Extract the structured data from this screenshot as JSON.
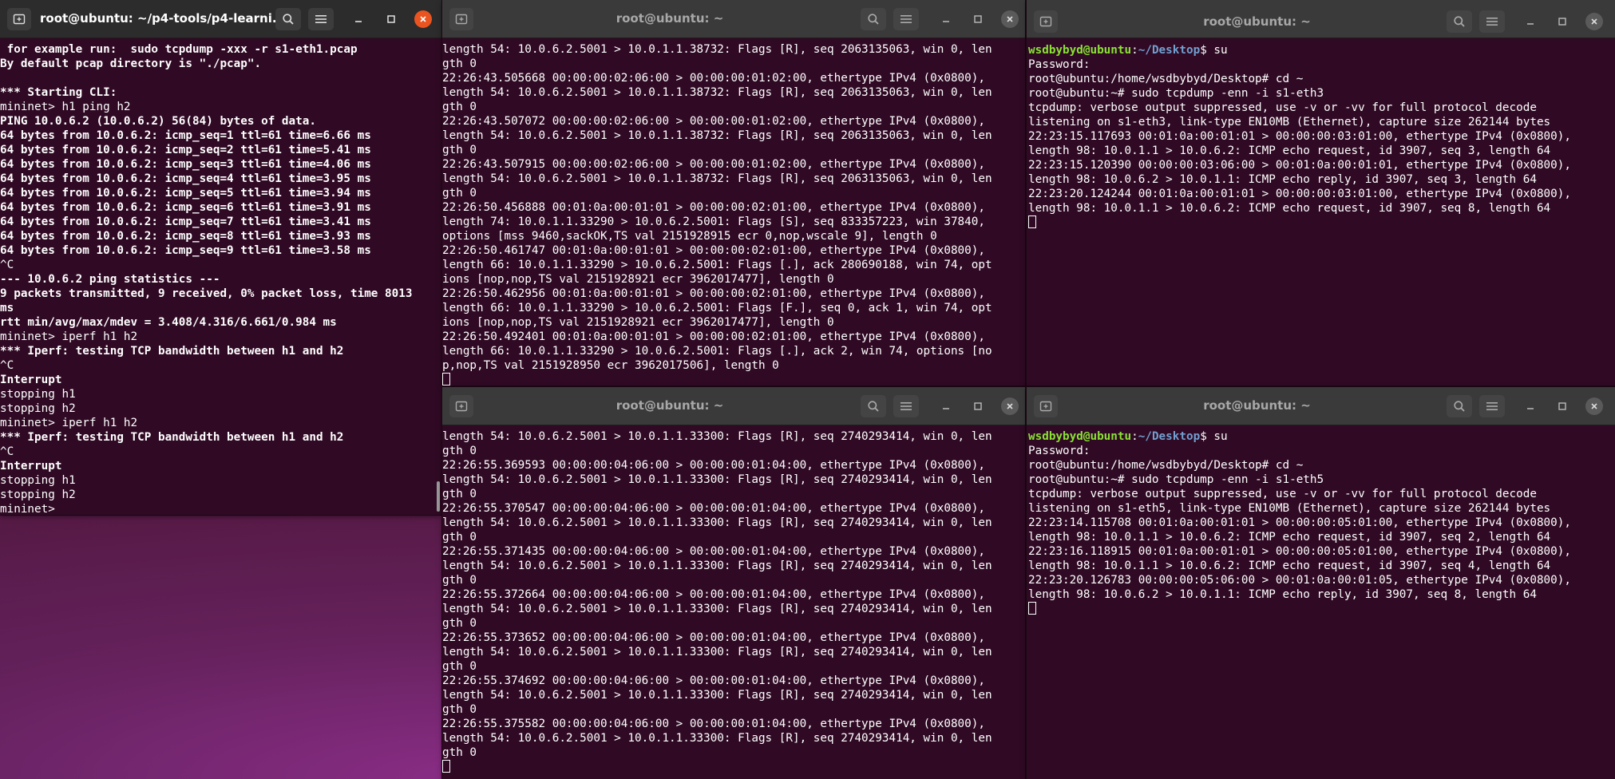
{
  "windows": [
    {
      "id": "terminal-mininet",
      "title": "root@ubuntu: ~/p4-tools/p4-learni...",
      "active": true,
      "lines": [
        [
          {
            "t": " for example run:  sudo tcpdump -xxx -r s1-eth1.pcap",
            "s": "b"
          }
        ],
        [
          {
            "t": "By default pcap directory is \"./pcap\".",
            "s": "b"
          }
        ],
        [
          {
            "t": ""
          }
        ],
        [
          {
            "t": "*** Starting CLI:",
            "s": "b"
          }
        ],
        [
          {
            "t": "mininet> h1 ping h2"
          }
        ],
        [
          {
            "t": "PING 10.0.6.2 (10.0.6.2) 56(84) bytes of data.",
            "s": "b"
          }
        ],
        [
          {
            "t": "64 bytes from 10.0.6.2: icmp_seq=1 ttl=61 time=6.66 ms",
            "s": "b"
          }
        ],
        [
          {
            "t": "64 bytes from 10.0.6.2: icmp_seq=2 ttl=61 time=5.41 ms",
            "s": "b"
          }
        ],
        [
          {
            "t": "64 bytes from 10.0.6.2: icmp_seq=3 ttl=61 time=4.06 ms",
            "s": "b"
          }
        ],
        [
          {
            "t": "64 bytes from 10.0.6.2: icmp_seq=4 ttl=61 time=3.95 ms",
            "s": "b"
          }
        ],
        [
          {
            "t": "64 bytes from 10.0.6.2: icmp_seq=5 ttl=61 time=3.94 ms",
            "s": "b"
          }
        ],
        [
          {
            "t": "64 bytes from 10.0.6.2: icmp_seq=6 ttl=61 time=3.91 ms",
            "s": "b"
          }
        ],
        [
          {
            "t": "64 bytes from 10.0.6.2: icmp_seq=7 ttl=61 time=3.41 ms",
            "s": "b"
          }
        ],
        [
          {
            "t": "64 bytes from 10.0.6.2: icmp_seq=8 ttl=61 time=3.93 ms",
            "s": "b"
          }
        ],
        [
          {
            "t": "64 bytes from 10.0.6.2: icmp_seq=9 ttl=61 time=3.58 ms",
            "s": "b"
          }
        ],
        [
          {
            "t": "^C"
          }
        ],
        [
          {
            "t": "--- 10.0.6.2 ping statistics ---",
            "s": "b"
          }
        ],
        [
          {
            "t": "9 packets transmitted, 9 received, 0% packet loss, time 8013",
            "s": "b"
          }
        ],
        [
          {
            "t": "ms",
            "s": "b"
          }
        ],
        [
          {
            "t": "rtt min/avg/max/mdev = 3.408/4.316/6.661/0.984 ms",
            "s": "b"
          }
        ],
        [
          {
            "t": "mininet> iperf h1 h2"
          }
        ],
        [
          {
            "t": "*** Iperf: testing TCP bandwidth between h1 and h2",
            "s": "b"
          }
        ],
        [
          {
            "t": "^C"
          }
        ],
        [
          {
            "t": "Interrupt",
            "s": "b"
          }
        ],
        [
          {
            "t": "stopping h1"
          }
        ],
        [
          {
            "t": "stopping h2"
          }
        ],
        [
          {
            "t": "mininet> iperf h1 h2"
          }
        ],
        [
          {
            "t": "*** Iperf: testing TCP bandwidth between h1 and h2",
            "s": "b"
          }
        ],
        [
          {
            "t": "^C"
          }
        ],
        [
          {
            "t": "Interrupt",
            "s": "b"
          }
        ],
        [
          {
            "t": "stopping h1"
          }
        ],
        [
          {
            "t": "stopping h2"
          }
        ],
        [
          {
            "t": "mininet> "
          }
        ]
      ]
    },
    {
      "id": "terminal-tcpdump-top",
      "title": "root@ubuntu: ~",
      "active": false,
      "lines": [
        [
          {
            "t": "length 54: 10.0.6.2.5001 > 10.0.1.1.38732: Flags [R], seq 2063135063, win 0, len"
          }
        ],
        [
          {
            "t": "gth 0"
          }
        ],
        [
          {
            "t": "22:26:43.505668 00:00:00:02:06:00 > 00:00:00:01:02:00, ethertype IPv4 (0x0800),"
          }
        ],
        [
          {
            "t": "length 54: 10.0.6.2.5001 > 10.0.1.1.38732: Flags [R], seq 2063135063, win 0, len"
          }
        ],
        [
          {
            "t": "gth 0"
          }
        ],
        [
          {
            "t": "22:26:43.507072 00:00:00:02:06:00 > 00:00:00:01:02:00, ethertype IPv4 (0x0800),"
          }
        ],
        [
          {
            "t": "length 54: 10.0.6.2.5001 > 10.0.1.1.38732: Flags [R], seq 2063135063, win 0, len"
          }
        ],
        [
          {
            "t": "gth 0"
          }
        ],
        [
          {
            "t": "22:26:43.507915 00:00:00:02:06:00 > 00:00:00:01:02:00, ethertype IPv4 (0x0800),"
          }
        ],
        [
          {
            "t": "length 54: 10.0.6.2.5001 > 10.0.1.1.38732: Flags [R], seq 2063135063, win 0, len"
          }
        ],
        [
          {
            "t": "gth 0"
          }
        ],
        [
          {
            "t": "22:26:50.456888 00:01:0a:00:01:01 > 00:00:00:02:01:00, ethertype IPv4 (0x0800),"
          }
        ],
        [
          {
            "t": "length 74: 10.0.1.1.33290 > 10.0.6.2.5001: Flags [S], seq 833357223, win 37840,"
          }
        ],
        [
          {
            "t": "options [mss 9460,sackOK,TS val 2151928915 ecr 0,nop,wscale 9], length 0"
          }
        ],
        [
          {
            "t": "22:26:50.461747 00:01:0a:00:01:01 > 00:00:00:02:01:00, ethertype IPv4 (0x0800),"
          }
        ],
        [
          {
            "t": "length 66: 10.0.1.1.33290 > 10.0.6.2.5001: Flags [.], ack 280690188, win 74, opt"
          }
        ],
        [
          {
            "t": "ions [nop,nop,TS val 2151928921 ecr 3962017477], length 0"
          }
        ],
        [
          {
            "t": "22:26:50.462956 00:01:0a:00:01:01 > 00:00:00:02:01:00, ethertype IPv4 (0x0800),"
          }
        ],
        [
          {
            "t": "length 66: 10.0.1.1.33290 > 10.0.6.2.5001: Flags [F.], seq 0, ack 1, win 74, opt"
          }
        ],
        [
          {
            "t": "ions [nop,nop,TS val 2151928921 ecr 3962017477], length 0"
          }
        ],
        [
          {
            "t": "22:26:50.492401 00:01:0a:00:01:01 > 00:00:00:02:01:00, ethertype IPv4 (0x0800),"
          }
        ],
        [
          {
            "t": "length 66: 10.0.1.1.33290 > 10.0.6.2.5001: Flags [.], ack 2, win 74, options [no"
          }
        ],
        [
          {
            "t": "p,nop,TS val 2151928950 ecr 3962017506], length 0"
          }
        ],
        [
          {
            "t": "",
            "cursor": true
          }
        ]
      ]
    },
    {
      "id": "terminal-s1-eth3",
      "title": "root@ubuntu: ~",
      "active": false,
      "lines": [
        [
          {
            "t": "wsdbybyd@ubuntu",
            "s": "pg"
          },
          {
            "t": ":"
          },
          {
            "t": "~/Desktop",
            "s": "pb"
          },
          {
            "t": "$ su"
          }
        ],
        [
          {
            "t": "Password:"
          }
        ],
        [
          {
            "t": "root@ubuntu:/home/wsdbybyd/Desktop# cd ~"
          }
        ],
        [
          {
            "t": "root@ubuntu:~# sudo tcpdump -enn -i s1-eth3"
          }
        ],
        [
          {
            "t": "tcpdump: verbose output suppressed, use -v or -vv for full protocol decode"
          }
        ],
        [
          {
            "t": "listening on s1-eth3, link-type EN10MB (Ethernet), capture size 262144 bytes"
          }
        ],
        [
          {
            "t": "22:23:15.117693 00:01:0a:00:01:01 > 00:00:00:03:01:00, ethertype IPv4 (0x0800),"
          }
        ],
        [
          {
            "t": "length 98: 10.0.1.1 > 10.0.6.2: ICMP echo request, id 3907, seq 3, length 64"
          }
        ],
        [
          {
            "t": "22:23:15.120390 00:00:00:03:06:00 > 00:01:0a:00:01:01, ethertype IPv4 (0x0800),"
          }
        ],
        [
          {
            "t": "length 98: 10.0.6.2 > 10.0.1.1: ICMP echo reply, id 3907, seq 3, length 64"
          }
        ],
        [
          {
            "t": "22:23:20.124244 00:01:0a:00:01:01 > 00:00:00:03:01:00, ethertype IPv4 (0x0800),"
          }
        ],
        [
          {
            "t": "length 98: 10.0.1.1 > 10.0.6.2: ICMP echo request, id 3907, seq 8, length 64"
          }
        ],
        [
          {
            "t": "",
            "cursor": true
          }
        ]
      ]
    },
    {
      "id": "terminal-tcpdump-bottom",
      "title": "root@ubuntu: ~",
      "active": false,
      "lines": [
        [
          {
            "t": "length 54: 10.0.6.2.5001 > 10.0.1.1.33300: Flags [R], seq 2740293414, win 0, len"
          }
        ],
        [
          {
            "t": "gth 0"
          }
        ],
        [
          {
            "t": "22:26:55.369593 00:00:00:04:06:00 > 00:00:00:01:04:00, ethertype IPv4 (0x0800),"
          }
        ],
        [
          {
            "t": "length 54: 10.0.6.2.5001 > 10.0.1.1.33300: Flags [R], seq 2740293414, win 0, len"
          }
        ],
        [
          {
            "t": "gth 0"
          }
        ],
        [
          {
            "t": "22:26:55.370547 00:00:00:04:06:00 > 00:00:00:01:04:00, ethertype IPv4 (0x0800),"
          }
        ],
        [
          {
            "t": "length 54: 10.0.6.2.5001 > 10.0.1.1.33300: Flags [R], seq 2740293414, win 0, len"
          }
        ],
        [
          {
            "t": "gth 0"
          }
        ],
        [
          {
            "t": "22:26:55.371435 00:00:00:04:06:00 > 00:00:00:01:04:00, ethertype IPv4 (0x0800),"
          }
        ],
        [
          {
            "t": "length 54: 10.0.6.2.5001 > 10.0.1.1.33300: Flags [R], seq 2740293414, win 0, len"
          }
        ],
        [
          {
            "t": "gth 0"
          }
        ],
        [
          {
            "t": "22:26:55.372664 00:00:00:04:06:00 > 00:00:00:01:04:00, ethertype IPv4 (0x0800),"
          }
        ],
        [
          {
            "t": "length 54: 10.0.6.2.5001 > 10.0.1.1.33300: Flags [R], seq 2740293414, win 0, len"
          }
        ],
        [
          {
            "t": "gth 0"
          }
        ],
        [
          {
            "t": "22:26:55.373652 00:00:00:04:06:00 > 00:00:00:01:04:00, ethertype IPv4 (0x0800),"
          }
        ],
        [
          {
            "t": "length 54: 10.0.6.2.5001 > 10.0.1.1.33300: Flags [R], seq 2740293414, win 0, len"
          }
        ],
        [
          {
            "t": "gth 0"
          }
        ],
        [
          {
            "t": "22:26:55.374692 00:00:00:04:06:00 > 00:00:00:01:04:00, ethertype IPv4 (0x0800),"
          }
        ],
        [
          {
            "t": "length 54: 10.0.6.2.5001 > 10.0.1.1.33300: Flags [R], seq 2740293414, win 0, len"
          }
        ],
        [
          {
            "t": "gth 0"
          }
        ],
        [
          {
            "t": "22:26:55.375582 00:00:00:04:06:00 > 00:00:00:01:04:00, ethertype IPv4 (0x0800),"
          }
        ],
        [
          {
            "t": "length 54: 10.0.6.2.5001 > 10.0.1.1.33300: Flags [R], seq 2740293414, win 0, len"
          }
        ],
        [
          {
            "t": "gth 0"
          }
        ],
        [
          {
            "t": "",
            "cursor": true
          }
        ]
      ]
    },
    {
      "id": "terminal-s1-eth5",
      "title": "root@ubuntu: ~",
      "active": false,
      "lines": [
        [
          {
            "t": "wsdbybyd@ubuntu",
            "s": "pg"
          },
          {
            "t": ":"
          },
          {
            "t": "~/Desktop",
            "s": "pb"
          },
          {
            "t": "$ su"
          }
        ],
        [
          {
            "t": "Password:"
          }
        ],
        [
          {
            "t": "root@ubuntu:/home/wsdbybyd/Desktop# cd ~"
          }
        ],
        [
          {
            "t": "root@ubuntu:~# sudo tcpdump -enn -i s1-eth5"
          }
        ],
        [
          {
            "t": "tcpdump: verbose output suppressed, use -v or -vv for full protocol decode"
          }
        ],
        [
          {
            "t": "listening on s1-eth5, link-type EN10MB (Ethernet), capture size 262144 bytes"
          }
        ],
        [
          {
            "t": "22:23:14.115708 00:01:0a:00:01:01 > 00:00:00:05:01:00, ethertype IPv4 (0x0800),"
          }
        ],
        [
          {
            "t": "length 98: 10.0.1.1 > 10.0.6.2: ICMP echo request, id 3907, seq 2, length 64"
          }
        ],
        [
          {
            "t": "22:23:16.118915 00:01:0a:00:01:01 > 00:00:00:05:01:00, ethertype IPv4 (0x0800),"
          }
        ],
        [
          {
            "t": "length 98: 10.0.1.1 > 10.0.6.2: ICMP echo request, id 3907, seq 4, length 64"
          }
        ],
        [
          {
            "t": "22:23:20.126783 00:00:00:05:06:00 > 00:01:0a:00:01:05, ethertype IPv4 (0x0800),"
          }
        ],
        [
          {
            "t": "length 98: 10.0.6.2 > 10.0.1.1: ICMP echo reply, id 3907, seq 8, length 64"
          }
        ],
        [
          {
            "t": "",
            "cursor": true
          }
        ]
      ]
    }
  ],
  "icons": {
    "new_tab": "new-tab-icon",
    "search": "search-icon",
    "menu": "hamburger-menu-icon",
    "minimize": "minimize-icon",
    "maximize": "maximize-icon",
    "close": "close-icon"
  },
  "colors": {
    "terminal_bg": "#300a24",
    "titlebar_active": "#2c2c2c",
    "close_active": "#e95420",
    "prompt_user": "#8ae234",
    "prompt_path": "#729fcf"
  }
}
